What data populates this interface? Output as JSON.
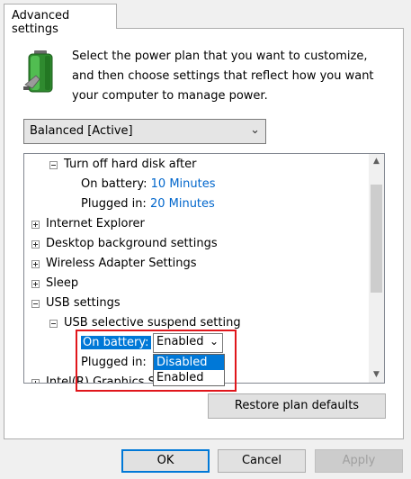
{
  "tab": {
    "label": "Advanced settings"
  },
  "intro": {
    "text": "Select the power plan that you want to customize, and then choose settings that reflect how you want your computer to manage power."
  },
  "plan": {
    "selected": "Balanced [Active]"
  },
  "tree": {
    "hard_disk": {
      "label": "Turn off hard disk after",
      "on_battery_label": "On battery:",
      "on_battery_value": "10 Minutes",
      "plugged_in_label": "Plugged in:",
      "plugged_in_value": "20 Minutes"
    },
    "internet_explorer": "Internet Explorer",
    "desktop_background": "Desktop background settings",
    "wireless_adapter": "Wireless Adapter Settings",
    "sleep": "Sleep",
    "usb": "USB settings",
    "usb_suspend": "USB selective suspend setting",
    "usb_on_battery_label": "On battery:",
    "usb_on_battery_value": "Enabled",
    "usb_plugged_in_label": "Plugged in:",
    "intel_graphics": "Intel(R) Graphics Settings"
  },
  "dropdown": {
    "options": [
      "Disabled",
      "Enabled"
    ]
  },
  "buttons": {
    "restore": "Restore plan defaults",
    "ok": "OK",
    "cancel": "Cancel",
    "apply": "Apply"
  },
  "colors": {
    "accent": "#0078d7",
    "link_value": "#0066cc",
    "highlight_box": "#e0161b"
  }
}
